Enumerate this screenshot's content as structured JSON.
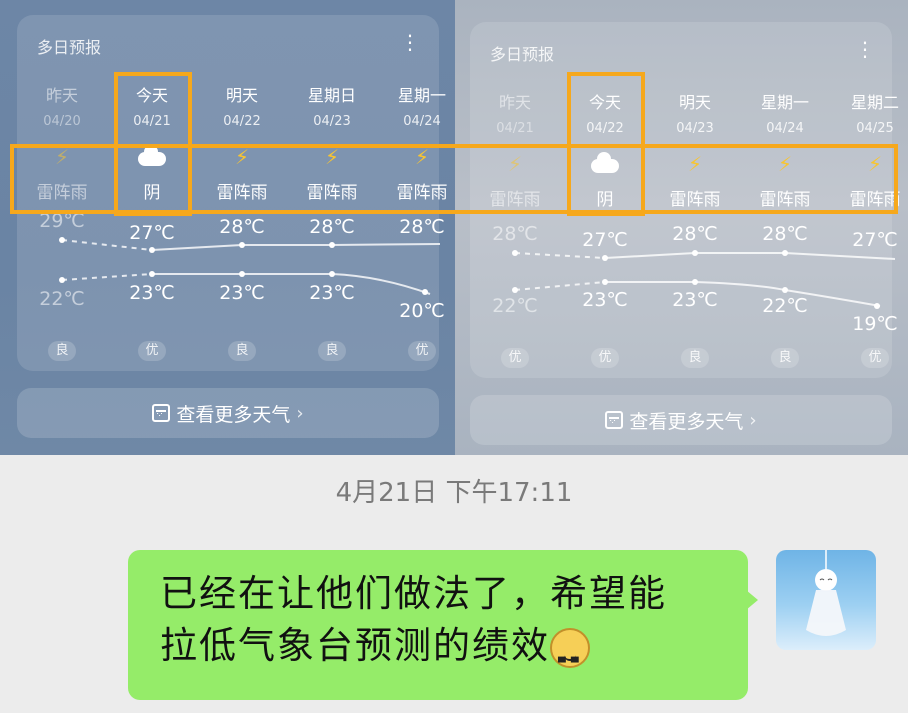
{
  "colors": {
    "highlight": "#f6a81c",
    "bubble": "#95ec69",
    "bolt": "#f7c531"
  },
  "left": {
    "title": "多日预报",
    "menu": "⋮",
    "more_label": "查看更多天气",
    "days": [
      {
        "name": "昨天",
        "date": "04/20",
        "weather": "雷阵雨",
        "icon": "thunder-icon",
        "high": "29℃",
        "low": "22℃",
        "aqi": "良"
      },
      {
        "name": "今天",
        "date": "04/21",
        "weather": "阴",
        "icon": "cloudy-icon",
        "high": "27℃",
        "low": "23℃",
        "aqi": "优"
      },
      {
        "name": "明天",
        "date": "04/22",
        "weather": "雷阵雨",
        "icon": "thunder-icon",
        "high": "28℃",
        "low": "23℃",
        "aqi": "良"
      },
      {
        "name": "星期日",
        "date": "04/23",
        "weather": "雷阵雨",
        "icon": "thunder-icon",
        "high": "28℃",
        "low": "23℃",
        "aqi": "良"
      },
      {
        "name": "星期一",
        "date": "04/24",
        "weather": "雷阵雨",
        "icon": "thunder-icon",
        "high": "28℃",
        "low": "20℃",
        "aqi": "优"
      }
    ]
  },
  "right": {
    "title": "多日预报",
    "menu": "⋮",
    "more_label": "查看更多天气",
    "days": [
      {
        "name": "昨天",
        "date": "04/21",
        "weather": "雷阵雨",
        "icon": "thunder-icon",
        "high": "28℃",
        "low": "22℃",
        "aqi": "优"
      },
      {
        "name": "今天",
        "date": "04/22",
        "weather": "阴",
        "icon": "cloudy-icon",
        "high": "27℃",
        "low": "23℃",
        "aqi": "优"
      },
      {
        "name": "明天",
        "date": "04/23",
        "weather": "雷阵雨",
        "icon": "thunder-icon",
        "high": "28℃",
        "low": "23℃",
        "aqi": "良"
      },
      {
        "name": "星期一",
        "date": "04/24",
        "weather": "雷阵雨",
        "icon": "thunder-icon",
        "high": "28℃",
        "low": "22℃",
        "aqi": "良"
      },
      {
        "name": "星期二",
        "date": "04/25",
        "weather": "雷阵雨",
        "icon": "thunder-icon",
        "high": "27℃",
        "low": "19℃",
        "aqi": "优"
      }
    ]
  },
  "chat": {
    "timestamp": "4月21日 下午17:11",
    "message_line1": "已经在让他们做法了，希望能",
    "message_line2": "拉低气象台预测的绩效",
    "emoji": "cat-face-emoji",
    "avatar": "teru-teru-bozu-avatar"
  }
}
